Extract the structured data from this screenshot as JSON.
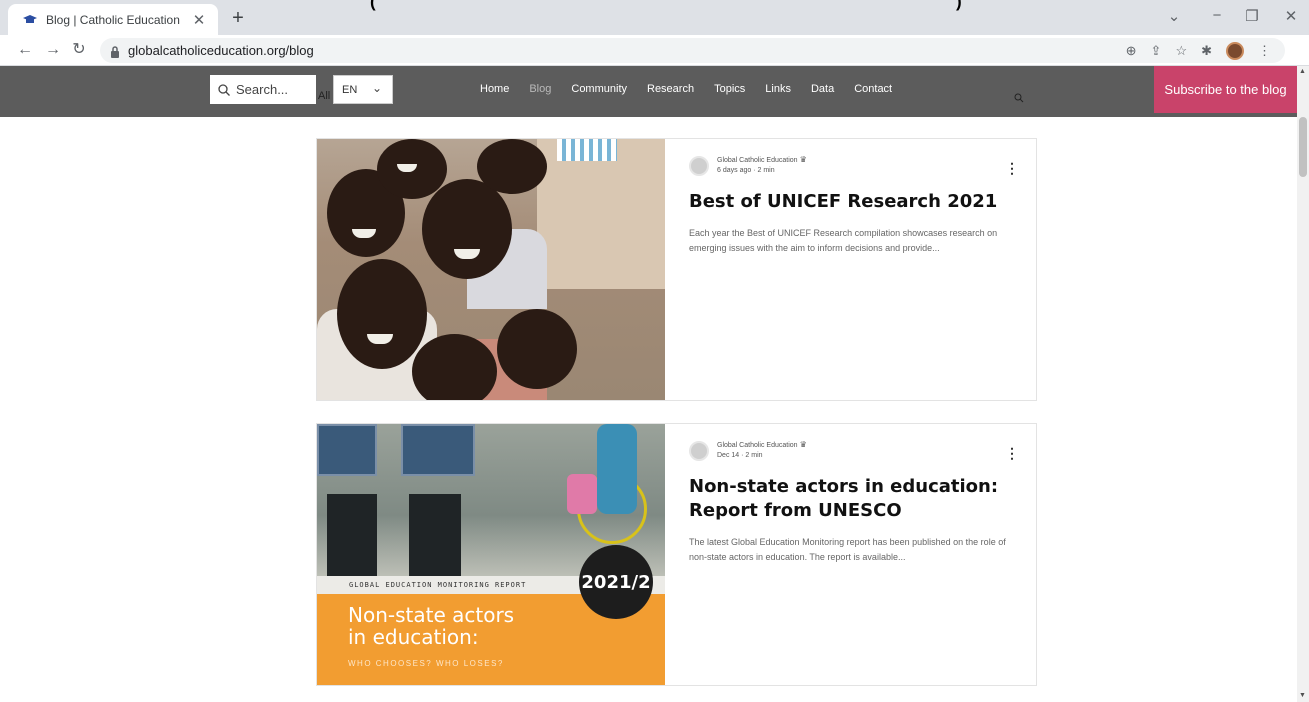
{
  "browser": {
    "tab_title": "Blog | Catholic Education",
    "url": "globalcatholiceducation.org/blog"
  },
  "site": {
    "search_placeholder": "Search...",
    "all_label": "All",
    "language": "EN",
    "nav": [
      "Home",
      "Blog",
      "Community",
      "Research",
      "Topics",
      "Links",
      "Data",
      "Contact"
    ],
    "active_nav": "Blog",
    "subscribe_label": "Subscribe to the blog",
    "accent_color": "#c9436a",
    "header_color": "#5c5c5c"
  },
  "posts": [
    {
      "author": "Global Catholic Education",
      "date": "6 days ago",
      "read_time": "2 min",
      "title": "Best of UNICEF Research 2021",
      "excerpt": "Each year the Best of UNICEF Research compilation showcases research on emerging issues with the aim to inform decisions and provide..."
    },
    {
      "author": "Global Catholic Education",
      "date": "Dec 14",
      "read_time": "2 min",
      "title": "Non-state actors in education: Report from UNESCO",
      "excerpt": "The latest Global Education Monitoring report has been published on the role of non-state actors in education. The report is available...",
      "image_text": {
        "strip": "GLOBAL EDUCATION MONITORING REPORT",
        "badge": "2021/2",
        "heading_line1": "Non-state actors",
        "heading_line2": "in education:",
        "subheading": "WHO CHOOSES? WHO LOSES?"
      }
    }
  ]
}
